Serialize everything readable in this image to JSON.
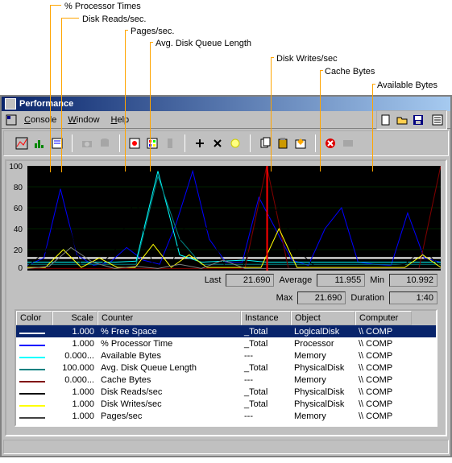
{
  "callouts": {
    "pct_processor": "% Processor Times",
    "disk_reads": "Disk Reads/sec.",
    "pages": "Pages/sec.",
    "avg_disk_queue": "Avg. Disk Queue Length",
    "disk_writes": "Disk Writes/sec",
    "cache_bytes": "Cache Bytes",
    "available_bytes": "Available Bytes"
  },
  "window": {
    "title": "Performance"
  },
  "menu": {
    "console": "Console",
    "window": "Window",
    "help": "Help"
  },
  "chart": {
    "y_ticks": [
      "100",
      "80",
      "60",
      "40",
      "20",
      "0"
    ]
  },
  "stats": {
    "last_label": "Last",
    "last_val": "21.690",
    "avg_label": "Average",
    "avg_val": "11.955",
    "min_label": "Min",
    "min_val": "10.992",
    "max_label": "Max",
    "max_val": "21.690",
    "dur_label": "Duration",
    "dur_val": "1:40"
  },
  "table": {
    "headers": {
      "color": "Color",
      "scale": "Scale",
      "counter": "Counter",
      "instance": "Instance",
      "object": "Object",
      "computer": "Computer"
    },
    "rows": [
      {
        "color": "#ffffff",
        "scale": "1.000",
        "counter": "% Free Space",
        "instance": "_Total",
        "object": "LogicalDisk",
        "computer": "\\\\ COMP",
        "selected": true
      },
      {
        "color": "#0000ff",
        "scale": "1.000",
        "counter": "% Processor Time",
        "instance": "_Total",
        "object": "Processor",
        "computer": "\\\\ COMP"
      },
      {
        "color": "#00ffff",
        "scale": "0.000...",
        "counter": "Available Bytes",
        "instance": "---",
        "object": "Memory",
        "computer": "\\\\ COMP"
      },
      {
        "color": "#008080",
        "scale": "100.000",
        "counter": "Avg. Disk Queue Length",
        "instance": "_Total",
        "object": "PhysicalDisk",
        "computer": "\\\\ COMP"
      },
      {
        "color": "#800000",
        "scale": "0.000...",
        "counter": "Cache Bytes",
        "instance": "---",
        "object": "Memory",
        "computer": "\\\\ COMP"
      },
      {
        "color": "#000000",
        "scale": "1.000",
        "counter": "Disk Reads/sec",
        "instance": "_Total",
        "object": "PhysicalDisk",
        "computer": "\\\\ COMP"
      },
      {
        "color": "#ffff00",
        "scale": "1.000",
        "counter": "Disk Writes/sec",
        "instance": "_Total",
        "object": "PhysicalDisk",
        "computer": "\\\\ COMP"
      },
      {
        "color": "#404040",
        "scale": "1.000",
        "counter": "Pages/sec",
        "instance": "---",
        "object": "Memory",
        "computer": "\\\\ COMP"
      }
    ]
  },
  "chart_data": {
    "type": "line",
    "ylim": [
      0,
      100
    ],
    "xrange": [
      0,
      100
    ],
    "note": "multi-line perf-monitor chart; values approximate from pixels",
    "series": [
      {
        "name": "% Free Space",
        "color": "#ffffff",
        "approx_values": [
          12,
          12,
          12,
          12,
          12,
          12,
          12,
          12,
          12,
          12,
          12,
          12,
          12,
          12,
          12,
          12,
          12,
          12,
          12,
          12
        ]
      },
      {
        "name": "% Processor Time",
        "color": "#0000ff",
        "approx_values": [
          5,
          12,
          78,
          15,
          5,
          8,
          22,
          10,
          6,
          45,
          95,
          30,
          8,
          8,
          70,
          40,
          10,
          5,
          40,
          60,
          8,
          6,
          5,
          55,
          12,
          8
        ]
      },
      {
        "name": "Available Bytes",
        "color": "#00ffff",
        "approx_values": [
          8,
          8,
          8,
          8,
          8,
          9,
          95,
          15,
          8,
          9,
          10,
          8,
          8,
          8,
          8,
          8,
          8,
          8,
          8,
          8
        ]
      },
      {
        "name": "Avg. Disk Queue Length",
        "color": "#008080",
        "approx_values": [
          6,
          6,
          6,
          6,
          6,
          6,
          90,
          30,
          6,
          6,
          6,
          6,
          6,
          6,
          6,
          6,
          6,
          6,
          6,
          6
        ]
      },
      {
        "name": "Cache Bytes",
        "color": "#800000",
        "approx_values": [
          2,
          2,
          2,
          2,
          2,
          2,
          2,
          2,
          2,
          2,
          2,
          100,
          2,
          2,
          2,
          2,
          2,
          2,
          2,
          100
        ]
      },
      {
        "name": "Disk Reads/sec",
        "color": "#000000",
        "approx_values": [
          4,
          18,
          60,
          4,
          4,
          22,
          70,
          4,
          4,
          55,
          40,
          4,
          4,
          45,
          60,
          20,
          4,
          4,
          4,
          4,
          4,
          6,
          20,
          4
        ]
      },
      {
        "name": "Disk Writes/sec",
        "color": "#ffff00",
        "approx_values": [
          3,
          3,
          20,
          3,
          12,
          3,
          3,
          25,
          3,
          15,
          3,
          3,
          3,
          3,
          40,
          3,
          3,
          3,
          3,
          3,
          3,
          3,
          15,
          3
        ]
      },
      {
        "name": "Pages/sec",
        "color": "#808080",
        "approx_values": [
          2,
          4,
          22,
          8,
          2,
          4,
          2,
          6,
          2,
          10,
          2,
          2,
          2,
          2,
          2,
          2,
          2,
          2,
          2,
          2
        ]
      }
    ],
    "cursor_position": 58
  }
}
